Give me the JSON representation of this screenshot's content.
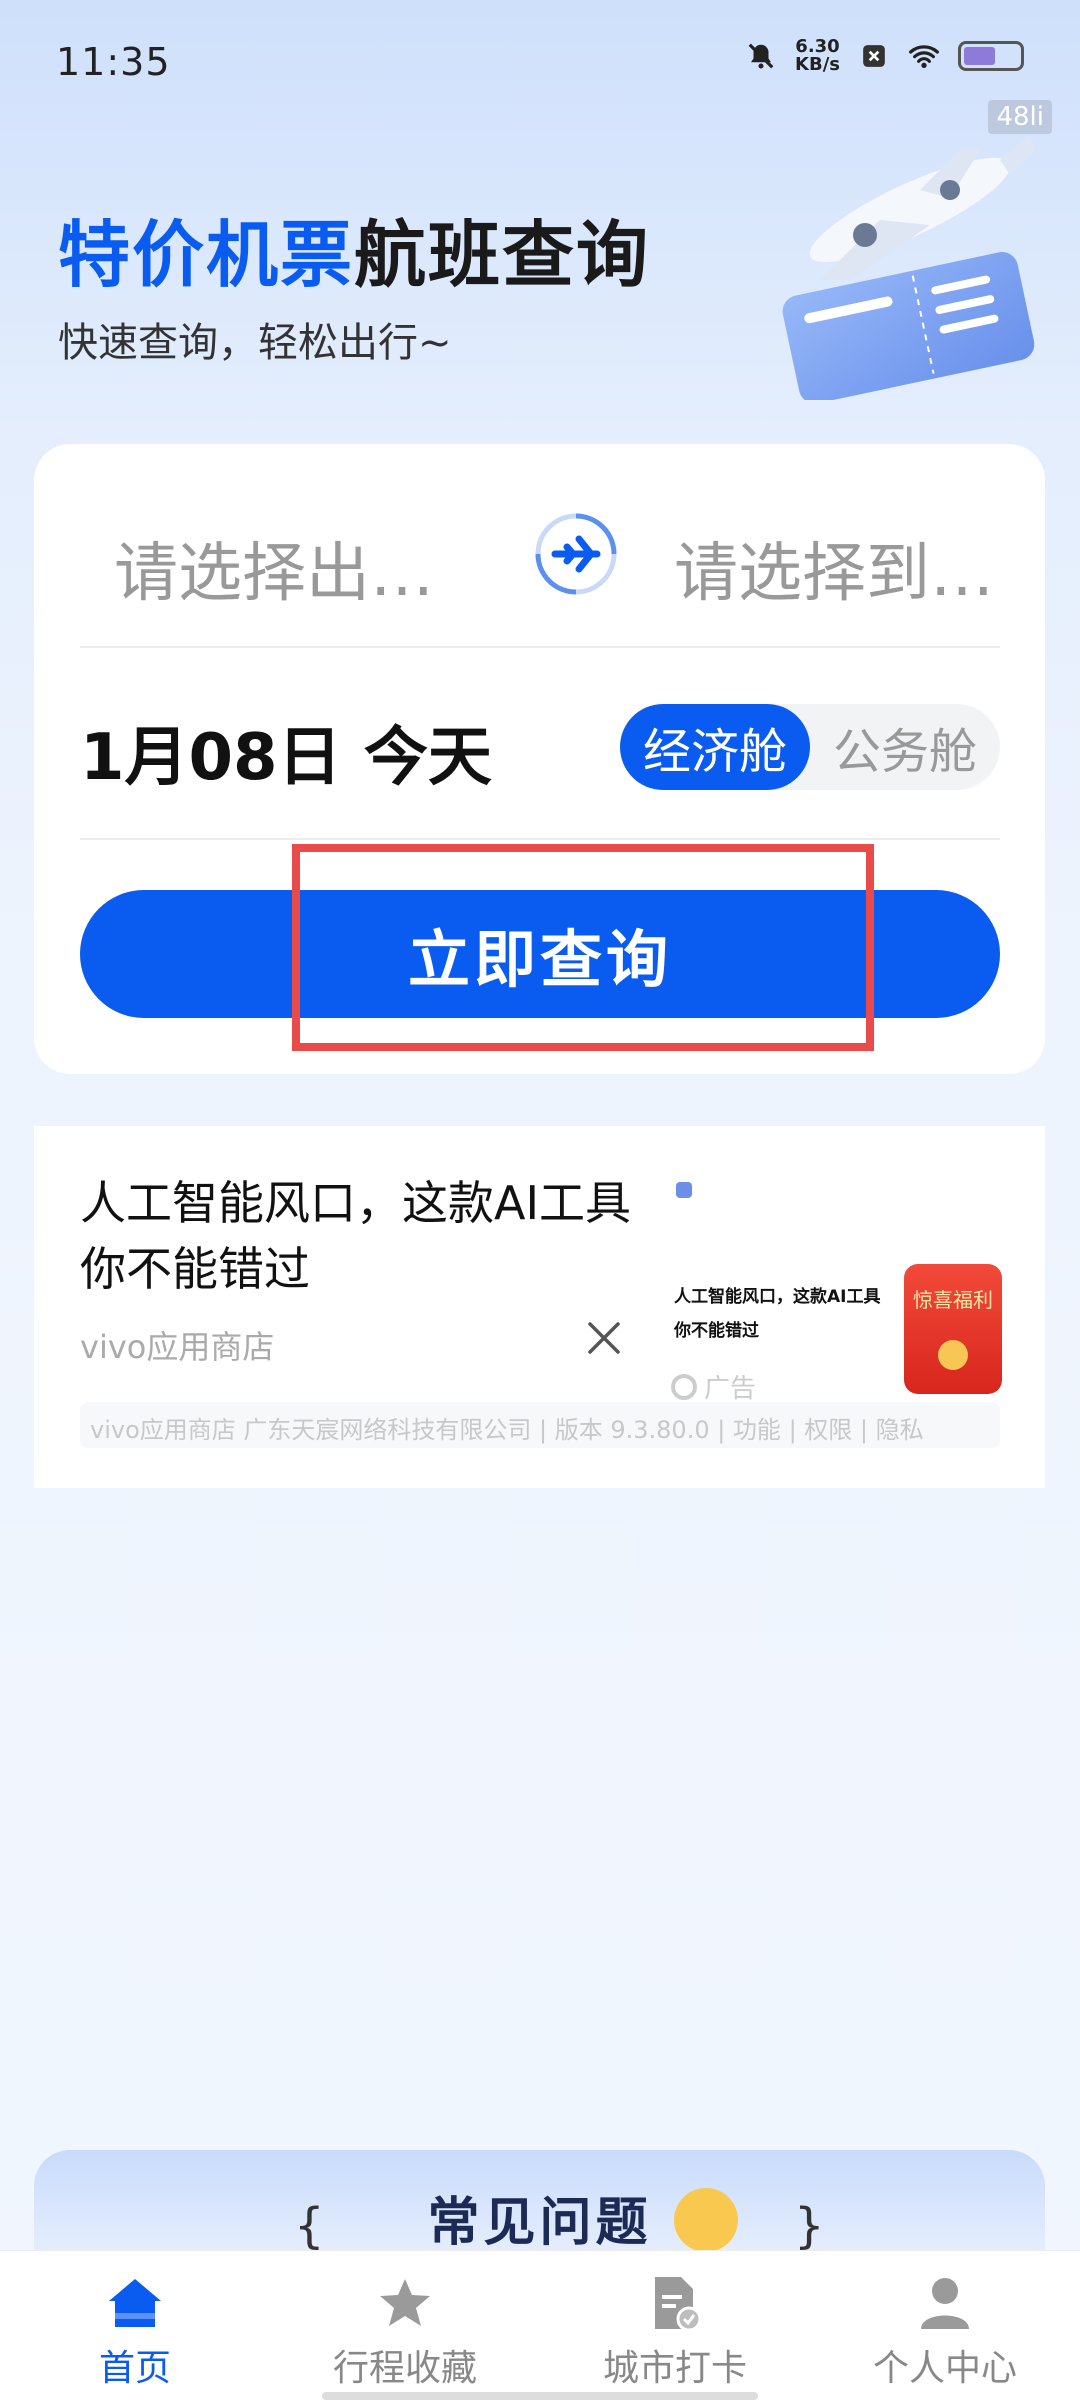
{
  "status_bar": {
    "time": "11:35",
    "speed_value": "6.30",
    "speed_unit": "KB/s",
    "watermark": "48li"
  },
  "hero": {
    "title_accent": "特价机票",
    "title_rest": "航班查询",
    "subtitle": "快速查询，轻松出行~"
  },
  "search": {
    "from_placeholder": "请选择出…",
    "to_placeholder": "请选择到…",
    "date": "1月08日 今天",
    "cabin_options": [
      "经济舱",
      "公务舱"
    ],
    "selected_cabin": "经济舱",
    "query_button": "立即查询"
  },
  "ad": {
    "title": "人工智能风口，这款AI工具你不能错过",
    "source": "vivo应用商店",
    "image_text": "人工智能风口，这款AI工具你不能错过",
    "badge": "广告",
    "redpack_label": "惊喜福利",
    "footer": "vivo应用商店 广东天宸网络科技有限公司 | 版本 9.3.80.0 | 功能 | 权限 | 隐私"
  },
  "faq": {
    "title": "常见问题"
  },
  "nav": {
    "items": [
      {
        "label": "首页",
        "icon": "home-icon",
        "active": true
      },
      {
        "label": "行程收藏",
        "icon": "star-icon",
        "active": false
      },
      {
        "label": "城市打卡",
        "icon": "checkin-doc-icon",
        "active": false
      },
      {
        "label": "个人中心",
        "icon": "user-icon",
        "active": false
      }
    ]
  },
  "colors": {
    "accent": "#0a5cf0",
    "highlight": "#e94a4a"
  }
}
